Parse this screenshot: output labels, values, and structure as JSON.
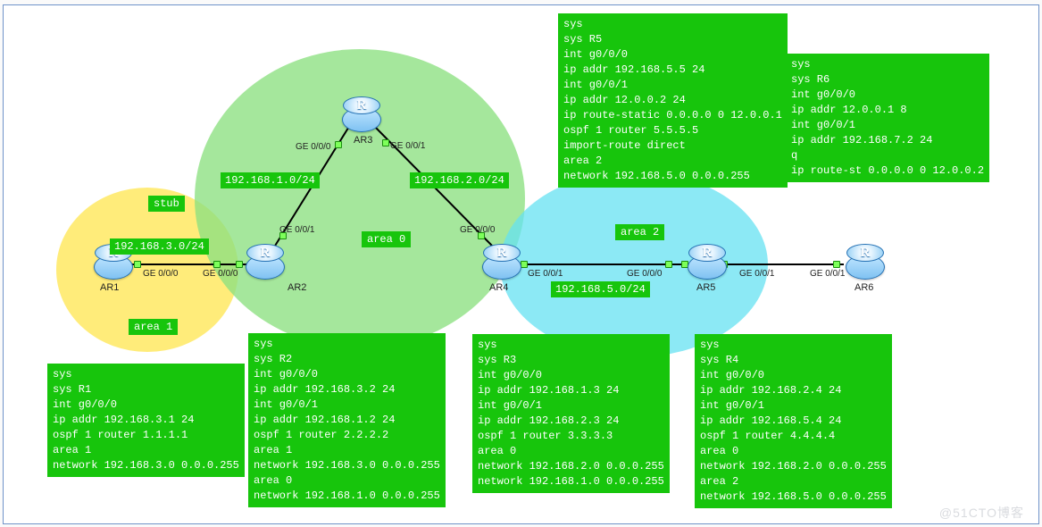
{
  "areas": {
    "a1": "area 1",
    "a0": "area 0",
    "a2": "area 2",
    "stub": "stub"
  },
  "routers": {
    "ar1": "AR1",
    "ar2": "AR2",
    "ar3": "AR3",
    "ar4": "AR4",
    "ar5": "AR5",
    "ar6": "AR6",
    "glyph": "R"
  },
  "subnets": {
    "s1": "192.168.3.0/24",
    "s2": "192.168.1.0/24",
    "s3": "192.168.2.0/24",
    "s4": "192.168.5.0/24"
  },
  "iface": {
    "ar1_g000": "GE 0/0/0",
    "ar2_g000": "GE 0/0/0",
    "ar2_g001": "GE 0/0/1",
    "ar3_g000": "GE 0/0/0",
    "ar3_g001": "GE 0/0/1",
    "ar4_g000": "GE 0/0/0",
    "ar4_g001": "GE 0/0/1",
    "ar5_g000": "GE 0/0/0",
    "ar5_g001": "GE 0/0/1",
    "ar6_g001": "GE 0/0/1"
  },
  "cfg": {
    "r1": "sys\nsys R1\nint g0/0/0\nip addr 192.168.3.1 24\nospf 1 router 1.1.1.1\narea 1\nnetwork 192.168.3.0 0.0.0.255",
    "r2": "sys\nsys R2\nint g0/0/0\nip addr 192.168.3.2 24\nint g0/0/1\nip addr 192.168.1.2 24\nospf 1 router 2.2.2.2\narea 1\nnetwork 192.168.3.0 0.0.0.255\narea 0\nnetwork 192.168.1.0 0.0.0.255",
    "r3": "sys\nsys R3\nint g0/0/0\nip addr 192.168.1.3 24\nint g0/0/1\nip addr 192.168.2.3 24\nospf 1 router 3.3.3.3\narea 0\nnetwork 192.168.2.0 0.0.0.255\nnetwork 192.168.1.0 0.0.0.255",
    "r4": "sys\nsys R4\nint g0/0/0\nip addr 192.168.2.4 24\nint g0/0/1\nip addr 192.168.5.4 24\nospf 1 router 4.4.4.4\narea 0\nnetwork 192.168.2.0 0.0.0.255\narea 2\nnetwork 192.168.5.0 0.0.0.255",
    "r5": "sys\nsys R5\nint g0/0/0\nip addr 192.168.5.5 24\nint g0/0/1\nip addr 12.0.0.2 24\nip route-static 0.0.0.0 0 12.0.0.1\nospf 1 router 5.5.5.5\nimport-route direct\narea 2\nnetwork 192.168.5.0 0.0.0.255",
    "r6": "sys\nsys R6\nint g0/0/0\nip addr 12.0.0.1 8\nint g0/0/1\nip addr 192.168.7.2 24\nq\nip route-st 0.0.0.0 0 12.0.0.2"
  },
  "watermark": "@51CTO博客"
}
